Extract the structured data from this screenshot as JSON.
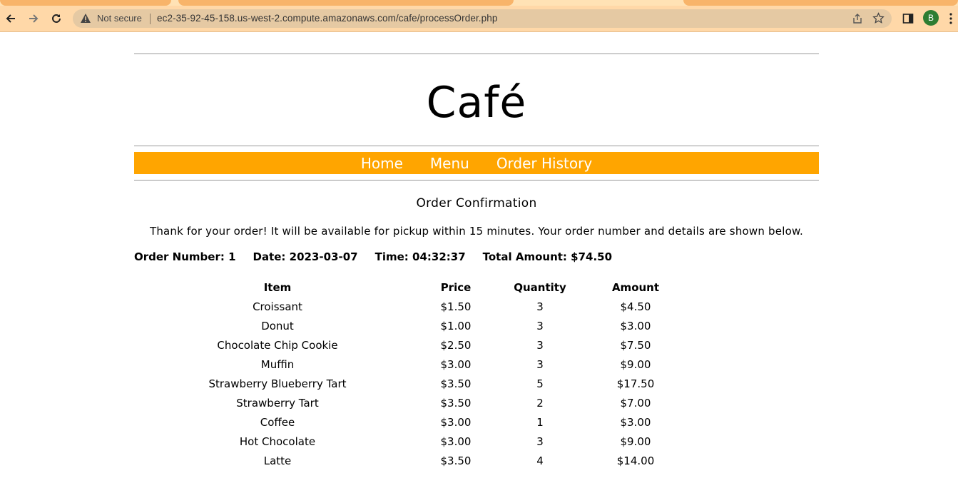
{
  "browser": {
    "security_label": "Not secure",
    "url": "ec2-35-92-45-158.us-west-2.compute.amazonaws.com/cafe/processOrder.php",
    "profile_initial": "B",
    "theme_color": "#ffd8a8"
  },
  "site": {
    "title": "Café",
    "nav": {
      "home": "Home",
      "menu": "Menu",
      "order_history": "Order History"
    },
    "accent_color": "#ffa500"
  },
  "confirmation": {
    "heading": "Order Confirmation",
    "message": "Thank for your order! It will be available for pickup within 15 minutes. Your order number and details are shown below.",
    "order_number": "Order Number: 1",
    "date": "Date: 2023-03-07",
    "time": "Time: 04:32:37",
    "total": "Total Amount: $74.50"
  },
  "table": {
    "headers": {
      "item": "Item",
      "price": "Price",
      "quantity": "Quantity",
      "amount": "Amount"
    },
    "rows": [
      {
        "item": "Croissant",
        "price": "$1.50",
        "quantity": "3",
        "amount": "$4.50"
      },
      {
        "item": "Donut",
        "price": "$1.00",
        "quantity": "3",
        "amount": "$3.00"
      },
      {
        "item": "Chocolate Chip Cookie",
        "price": "$2.50",
        "quantity": "3",
        "amount": "$7.50"
      },
      {
        "item": "Muffin",
        "price": "$3.00",
        "quantity": "3",
        "amount": "$9.00"
      },
      {
        "item": "Strawberry Blueberry Tart",
        "price": "$3.50",
        "quantity": "5",
        "amount": "$17.50"
      },
      {
        "item": "Strawberry Tart",
        "price": "$3.50",
        "quantity": "2",
        "amount": "$7.00"
      },
      {
        "item": "Coffee",
        "price": "$3.00",
        "quantity": "1",
        "amount": "$3.00"
      },
      {
        "item": "Hot Chocolate",
        "price": "$3.00",
        "quantity": "3",
        "amount": "$9.00"
      },
      {
        "item": "Latte",
        "price": "$3.50",
        "quantity": "4",
        "amount": "$14.00"
      }
    ]
  }
}
